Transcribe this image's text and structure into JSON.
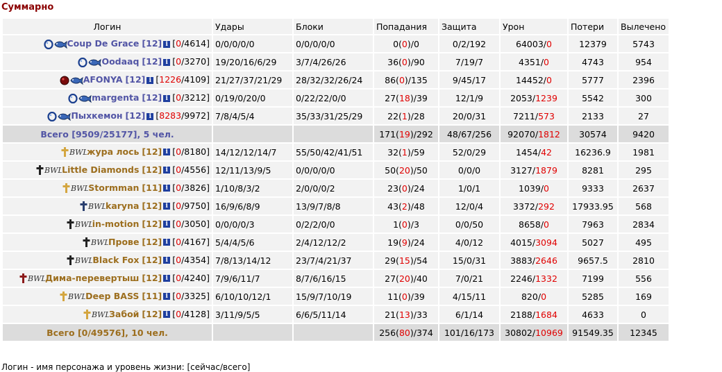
{
  "title": "Суммарно",
  "headers": [
    "Логин",
    "Удары",
    "Блоки",
    "Попадания",
    "Защита",
    "Урон",
    "Потери",
    "Вылечено"
  ],
  "team1": [
    {
      "name": "Coup De Grace",
      "level": "[12]",
      "hp_cur": "0",
      "hp_max": "4614",
      "hits": "0/0/0/0/0",
      "blocks": "0/0/0/0/0",
      "acc_a": "0",
      "acc_b": "0",
      "acc_c": "0",
      "defense": "0/2/192",
      "dmg_a": "64003",
      "dmg_b": "0",
      "losses": "12379",
      "healed": "5743",
      "icon": "orb"
    },
    {
      "name": "Oodaaq",
      "level": "[12]",
      "hp_cur": "0",
      "hp_max": "3270",
      "hits": "19/20/16/6/29",
      "blocks": "3/7/4/26/26",
      "acc_a": "36",
      "acc_b": "0",
      "acc_c": "90",
      "defense": "7/19/7",
      "dmg_a": "4351",
      "dmg_b": "0",
      "losses": "4743",
      "healed": "954",
      "icon": "orb"
    },
    {
      "name": "AFONYA",
      "level": "[12]",
      "hp_cur": "1226",
      "hp_max": "4109",
      "hits": "21/27/37/21/29",
      "blocks": "28/32/32/26/24",
      "acc_a": "86",
      "acc_b": "0",
      "acc_c": "135",
      "defense": "9/45/17",
      "dmg_a": "14452",
      "dmg_b": "0",
      "losses": "5777",
      "healed": "2396",
      "icon": "red-orb"
    },
    {
      "name": "margenta",
      "level": "[12]",
      "hp_cur": "0",
      "hp_max": "3212",
      "hits": "0/19/0/20/0",
      "blocks": "0/22/22/0/0",
      "acc_a": "27",
      "acc_b": "18",
      "acc_c": "39",
      "defense": "12/1/9",
      "dmg_a": "2053",
      "dmg_b": "1239",
      "losses": "5542",
      "healed": "300",
      "icon": "orb"
    },
    {
      "name": "Пыхкемон",
      "level": "[12]",
      "hp_cur": "8283",
      "hp_max": "9972",
      "hits": "7/8/4/5/4",
      "blocks": "35/33/31/25/29",
      "acc_a": "22",
      "acc_b": "1",
      "acc_c": "28",
      "defense": "20/0/31",
      "dmg_a": "7211",
      "dmg_b": "573",
      "losses": "2133",
      "healed": "27",
      "icon": "orb"
    }
  ],
  "total1": {
    "label": "Всего [9509/25177], 5 чел.",
    "acc_a": "171",
    "acc_b": "19",
    "acc_c": "292",
    "defense": "48/67/256",
    "dmg_a": "92070",
    "dmg_b": "1812",
    "losses": "30574",
    "healed": "9420"
  },
  "team2": [
    {
      "name": "жура лось",
      "level": "[12]",
      "hp_cur": "0",
      "hp_max": "8180",
      "hits": "14/12/12/14/7",
      "blocks": "55/50/42/41/51",
      "acc_a": "32",
      "acc_b": "1",
      "acc_c": "59",
      "defense": "52/0/29",
      "dmg_a": "1454",
      "dmg_b": "42",
      "losses": "16236.9",
      "healed": "1981",
      "cross": "gold"
    },
    {
      "name": "Little Diamonds",
      "level": "[12]",
      "hp_cur": "0",
      "hp_max": "4556",
      "hits": "12/11/13/9/5",
      "blocks": "0/0/0/0/0",
      "acc_a": "50",
      "acc_b": "20",
      "acc_c": "50",
      "defense": "0/0/0",
      "dmg_a": "3127",
      "dmg_b": "1879",
      "losses": "8281",
      "healed": "295",
      "cross": "black"
    },
    {
      "name": "Stormman",
      "level": "[11]",
      "hp_cur": "0",
      "hp_max": "3826",
      "hits": "1/10/8/3/2",
      "blocks": "2/0/0/0/2",
      "acc_a": "23",
      "acc_b": "0",
      "acc_c": "24",
      "defense": "1/0/1",
      "dmg_a": "1039",
      "dmg_b": "0",
      "losses": "9333",
      "healed": "2637",
      "cross": "gold"
    },
    {
      "name": "karyna",
      "level": "[12]",
      "hp_cur": "0",
      "hp_max": "9750",
      "hits": "16/9/6/8/9",
      "blocks": "13/9/7/8/8",
      "acc_a": "43",
      "acc_b": "2",
      "acc_c": "48",
      "defense": "12/0/4",
      "dmg_a": "3372",
      "dmg_b": "292",
      "losses": "17933.95",
      "healed": "568",
      "cross": "blue"
    },
    {
      "name": "in-motion",
      "level": "[12]",
      "hp_cur": "0",
      "hp_max": "3050",
      "hits": "0/0/0/0/3",
      "blocks": "0/2/2/0/0",
      "acc_a": "1",
      "acc_b": "0",
      "acc_c": "3",
      "defense": "0/0/50",
      "dmg_a": "8658",
      "dmg_b": "0",
      "losses": "7963",
      "healed": "2834",
      "cross": "black"
    },
    {
      "name": "Прове",
      "level": "[12]",
      "hp_cur": "0",
      "hp_max": "4167",
      "hits": "5/4/4/5/6",
      "blocks": "2/4/12/12/2",
      "acc_a": "19",
      "acc_b": "9",
      "acc_c": "24",
      "defense": "4/0/12",
      "dmg_a": "4015",
      "dmg_b": "3094",
      "losses": "5027",
      "healed": "495",
      "cross": "black"
    },
    {
      "name": "Black Fox",
      "level": "[12]",
      "hp_cur": "0",
      "hp_max": "4354",
      "hits": "7/8/13/14/12",
      "blocks": "23/7/4/21/37",
      "acc_a": "29",
      "acc_b": "15",
      "acc_c": "54",
      "defense": "15/0/31",
      "dmg_a": "3883",
      "dmg_b": "2646",
      "losses": "9657.5",
      "healed": "2810",
      "cross": "black"
    },
    {
      "name": "Дима-перевертыш",
      "level": "[12]",
      "hp_cur": "0",
      "hp_max": "4240",
      "hits": "7/9/6/11/7",
      "blocks": "8/7/6/16/15",
      "acc_a": "27",
      "acc_b": "20",
      "acc_c": "40",
      "defense": "7/0/21",
      "dmg_a": "2246",
      "dmg_b": "1332",
      "losses": "7199",
      "healed": "556",
      "cross": "red"
    },
    {
      "name": "Deep BASS",
      "level": "[11]",
      "hp_cur": "0",
      "hp_max": "3325",
      "hits": "6/10/10/12/1",
      "blocks": "15/9/7/10/19",
      "acc_a": "11",
      "acc_b": "0",
      "acc_c": "39",
      "defense": "4/15/11",
      "dmg_a": "820",
      "dmg_b": "0",
      "losses": "5285",
      "healed": "169",
      "cross": "gold"
    },
    {
      "name": "Забой",
      "level": "[12]",
      "hp_cur": "0",
      "hp_max": "4128",
      "hits": "3/11/9/5/5",
      "blocks": "6/6/5/11/14",
      "acc_a": "21",
      "acc_b": "13",
      "acc_c": "33",
      "defense": "6/1/14",
      "dmg_a": "2188",
      "dmg_b": "1684",
      "losses": "4633",
      "healed": "0",
      "cross": "gold"
    }
  ],
  "total2": {
    "label": "Всего [0/49576], 10 чел.",
    "acc_a": "256",
    "acc_b": "80",
    "acc_c": "374",
    "defense": "101/16/173",
    "dmg_a": "30802",
    "dmg_b": "10969",
    "losses": "91549.35",
    "healed": "12345"
  },
  "footer": "Логин - имя персонажа и уровень жизни: [сейчас/всего]",
  "icons": {
    "info": "i",
    "clan_text": "BWL"
  },
  "colors": {
    "team1": "#5255a5",
    "team2": "#9c6e1e",
    "damage_red": "#e00000",
    "title": "#8b0000"
  }
}
